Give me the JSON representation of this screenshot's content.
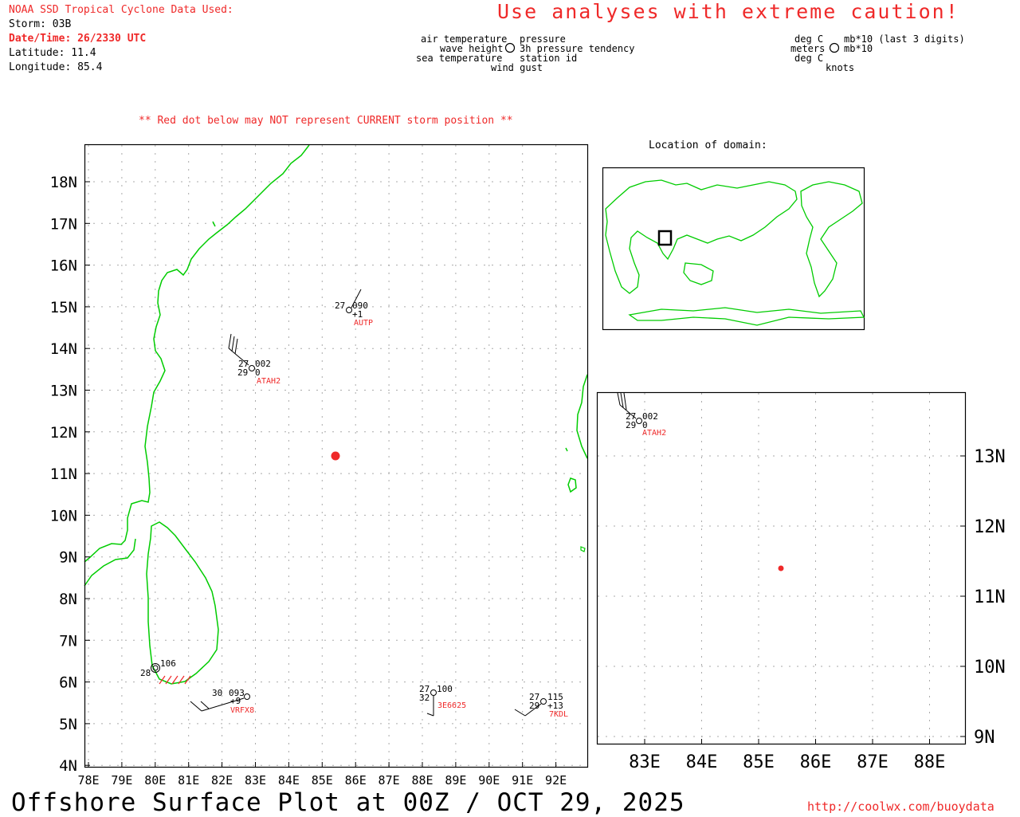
{
  "header": {
    "line1": "NOAA SSD Tropical Cyclone Data Used:",
    "storm": "Storm: 03B",
    "datetime": "Date/Time: 26/2330 UTC",
    "latitude": "Latitude: 11.4",
    "longitude": "Longitude: 85.4"
  },
  "caution": "Use analyses with extreme caution!",
  "legend": {
    "left_top": "air temperature",
    "left_mid": "wave height",
    "left_bot": "sea temperature",
    "right_top": "pressure",
    "right_mid": "3h pressure tendency",
    "right_bot": "station id",
    "bottom": "wind gust",
    "units_left_top": "deg C",
    "units_left_mid": "meters",
    "units_left_bot": "deg C",
    "units_right_top": "mb*10 (last 3 digits)",
    "units_right_mid": "mb*10",
    "units_bottom": "knots"
  },
  "warning": "** Red dot below may NOT represent CURRENT storm position **",
  "location_title": "Location of domain:",
  "main_map": {
    "lat_labels": [
      "18N",
      "17N",
      "16N",
      "15N",
      "14N",
      "13N",
      "12N",
      "11N",
      "10N",
      "9N",
      "8N",
      "7N",
      "6N",
      "5N",
      "4N"
    ],
    "lon_labels": [
      "78E",
      "79E",
      "80E",
      "81E",
      "82E",
      "83E",
      "84E",
      "85E",
      "86E",
      "87E",
      "88E",
      "89E",
      "90E",
      "91E",
      "92E"
    ],
    "storm_position": {
      "lat": 11.4,
      "lon": 85.4
    },
    "stations": [
      {
        "id": "AUTP",
        "air_temp": "27",
        "pressure": "090",
        "tendency": "+1",
        "sea_temp": "",
        "wave": ""
      },
      {
        "id": "ATAH2",
        "air_temp": "27",
        "pressure": "002",
        "tendency": "",
        "sea_temp": "29",
        "wave": "0"
      },
      {
        "id": "VRFX8",
        "air_temp": "30",
        "pressure": "093",
        "tendency": "+9",
        "sea_temp": "",
        "wave": ""
      },
      {
        "id": "3E6625",
        "air_temp": "27",
        "pressure": "100",
        "tendency": "",
        "sea_temp": "32",
        "wave": ""
      },
      {
        "id": "7KDL",
        "air_temp": "27",
        "pressure": "115",
        "tendency": "+13",
        "sea_temp": "29",
        "wave": ""
      },
      {
        "id": "",
        "air_temp": "28",
        "pressure": "106",
        "tendency": "",
        "sea_temp": "",
        "wave": ""
      }
    ]
  },
  "zoom_map": {
    "lat_labels": [
      "13N",
      "12N",
      "11N",
      "10N",
      "9N"
    ],
    "lon_labels": [
      "83E",
      "84E",
      "85E",
      "86E",
      "87E",
      "88E"
    ],
    "station": {
      "id": "ATAH2",
      "air_temp": "27",
      "pressure": "002",
      "sea_temp": "29",
      "wave": "0"
    }
  },
  "footer": {
    "title": "Offshore Surface Plot at 00Z / OCT 29, 2025",
    "url": "http://coolwx.com/buoydata"
  },
  "colors": {
    "land": "#00cc00",
    "text_red": "#ef2929",
    "grid": "#aaaaaa",
    "storm": "#ef2929"
  }
}
